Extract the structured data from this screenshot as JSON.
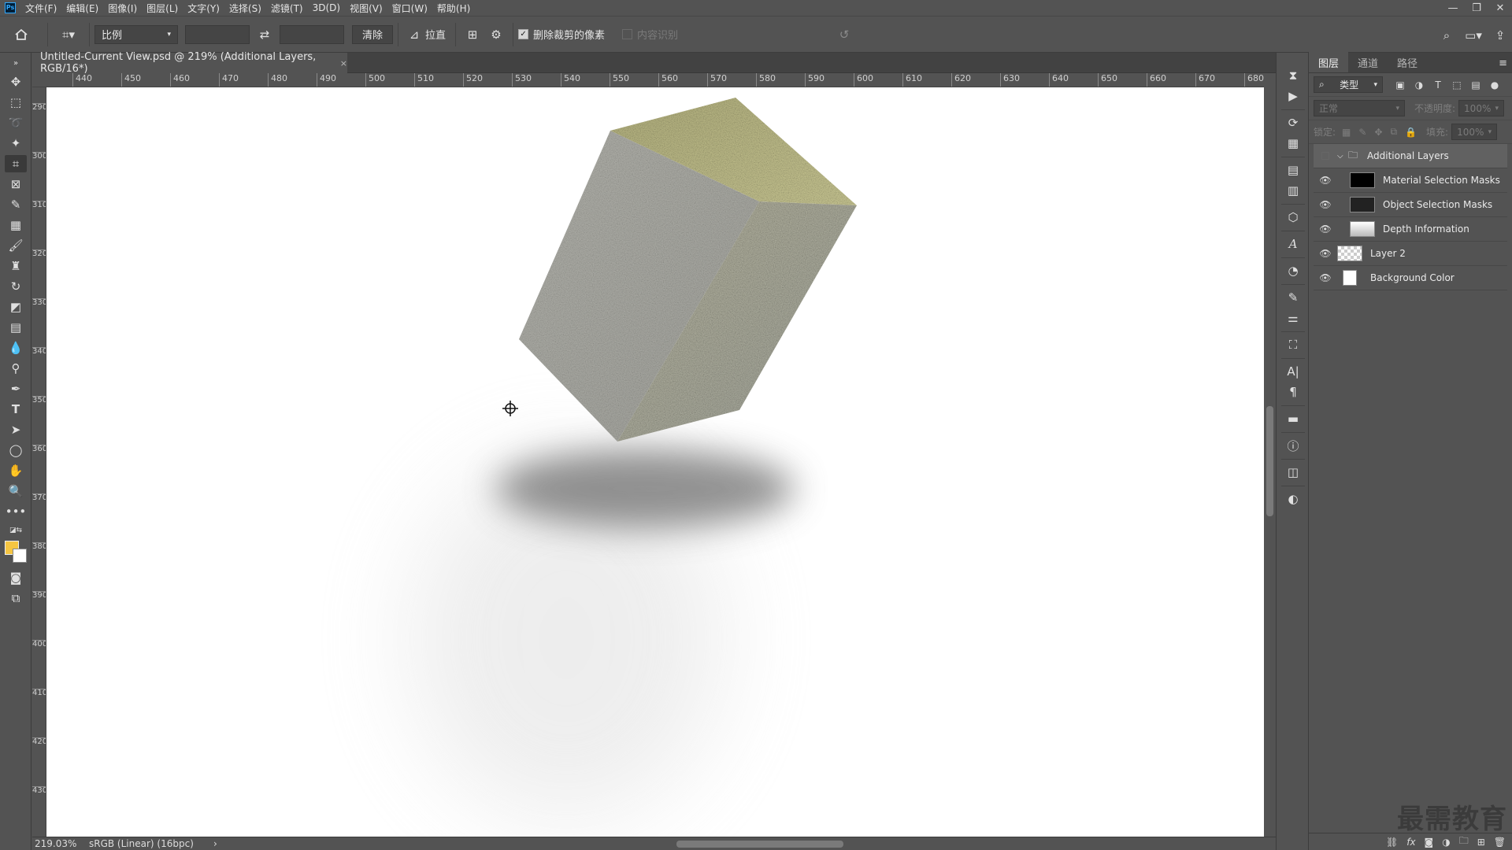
{
  "menubar": {
    "logo": "Ps",
    "items": [
      "文件(F)",
      "编辑(E)",
      "图像(I)",
      "图层(L)",
      "文字(Y)",
      "选择(S)",
      "滤镜(T)",
      "3D(D)",
      "视图(V)",
      "窗口(W)",
      "帮助(H)"
    ]
  },
  "options": {
    "ratio_select": "比例",
    "clear_label": "清除",
    "straighten_label": "拉直",
    "delete_cropped_label": "删除裁剪的像素",
    "delete_cropped_checked": true,
    "content_aware_label": "内容识别",
    "content_aware_checked": false
  },
  "document": {
    "tab_title": "Untitled-Current View.psd @ 219% (Additional Layers, RGB/16*)",
    "close_glyph": "×"
  },
  "ruler_top": [
    "440",
    "450",
    "460",
    "470",
    "480",
    "490",
    "500",
    "510",
    "520",
    "530",
    "540",
    "550",
    "560",
    "570",
    "580",
    "590",
    "600",
    "610",
    "620",
    "630",
    "640",
    "650",
    "660",
    "670",
    "680"
  ],
  "ruler_left": [
    "290",
    "300",
    "310",
    "320",
    "330",
    "340",
    "350",
    "360",
    "370",
    "380",
    "390",
    "400",
    "410",
    "420",
    "430"
  ],
  "status": {
    "zoom": "219.03%",
    "profile": "sRGB (Linear) (16bpc)",
    "arrow": "›"
  },
  "layers_panel": {
    "tabs": [
      "图层",
      "通道",
      "路径"
    ],
    "filter_select": "类型",
    "blend_mode": "正常",
    "opacity_label": "不透明度:",
    "opacity_value": "100%",
    "lock_label": "锁定:",
    "fill_label": "填充:",
    "fill_value": "100%",
    "layers": [
      {
        "name": "Additional Layers",
        "type": "group",
        "visible": false
      },
      {
        "name": "Material Selection Masks",
        "type": "child",
        "visible": true,
        "thumb": "black"
      },
      {
        "name": "Object Selection Masks",
        "type": "child",
        "visible": true,
        "thumb": "dark"
      },
      {
        "name": "Depth Information",
        "type": "child",
        "visible": true,
        "thumb": "gradient"
      },
      {
        "name": "Layer 2",
        "type": "layer",
        "visible": true,
        "thumb": "transparent"
      },
      {
        "name": "Background Color",
        "type": "layer",
        "visible": true,
        "thumb": "white"
      }
    ]
  },
  "watermark": "最需教育",
  "colors": {
    "foreground": "#f5c542",
    "background": "#ffffff",
    "ui_bg": "#535353"
  }
}
